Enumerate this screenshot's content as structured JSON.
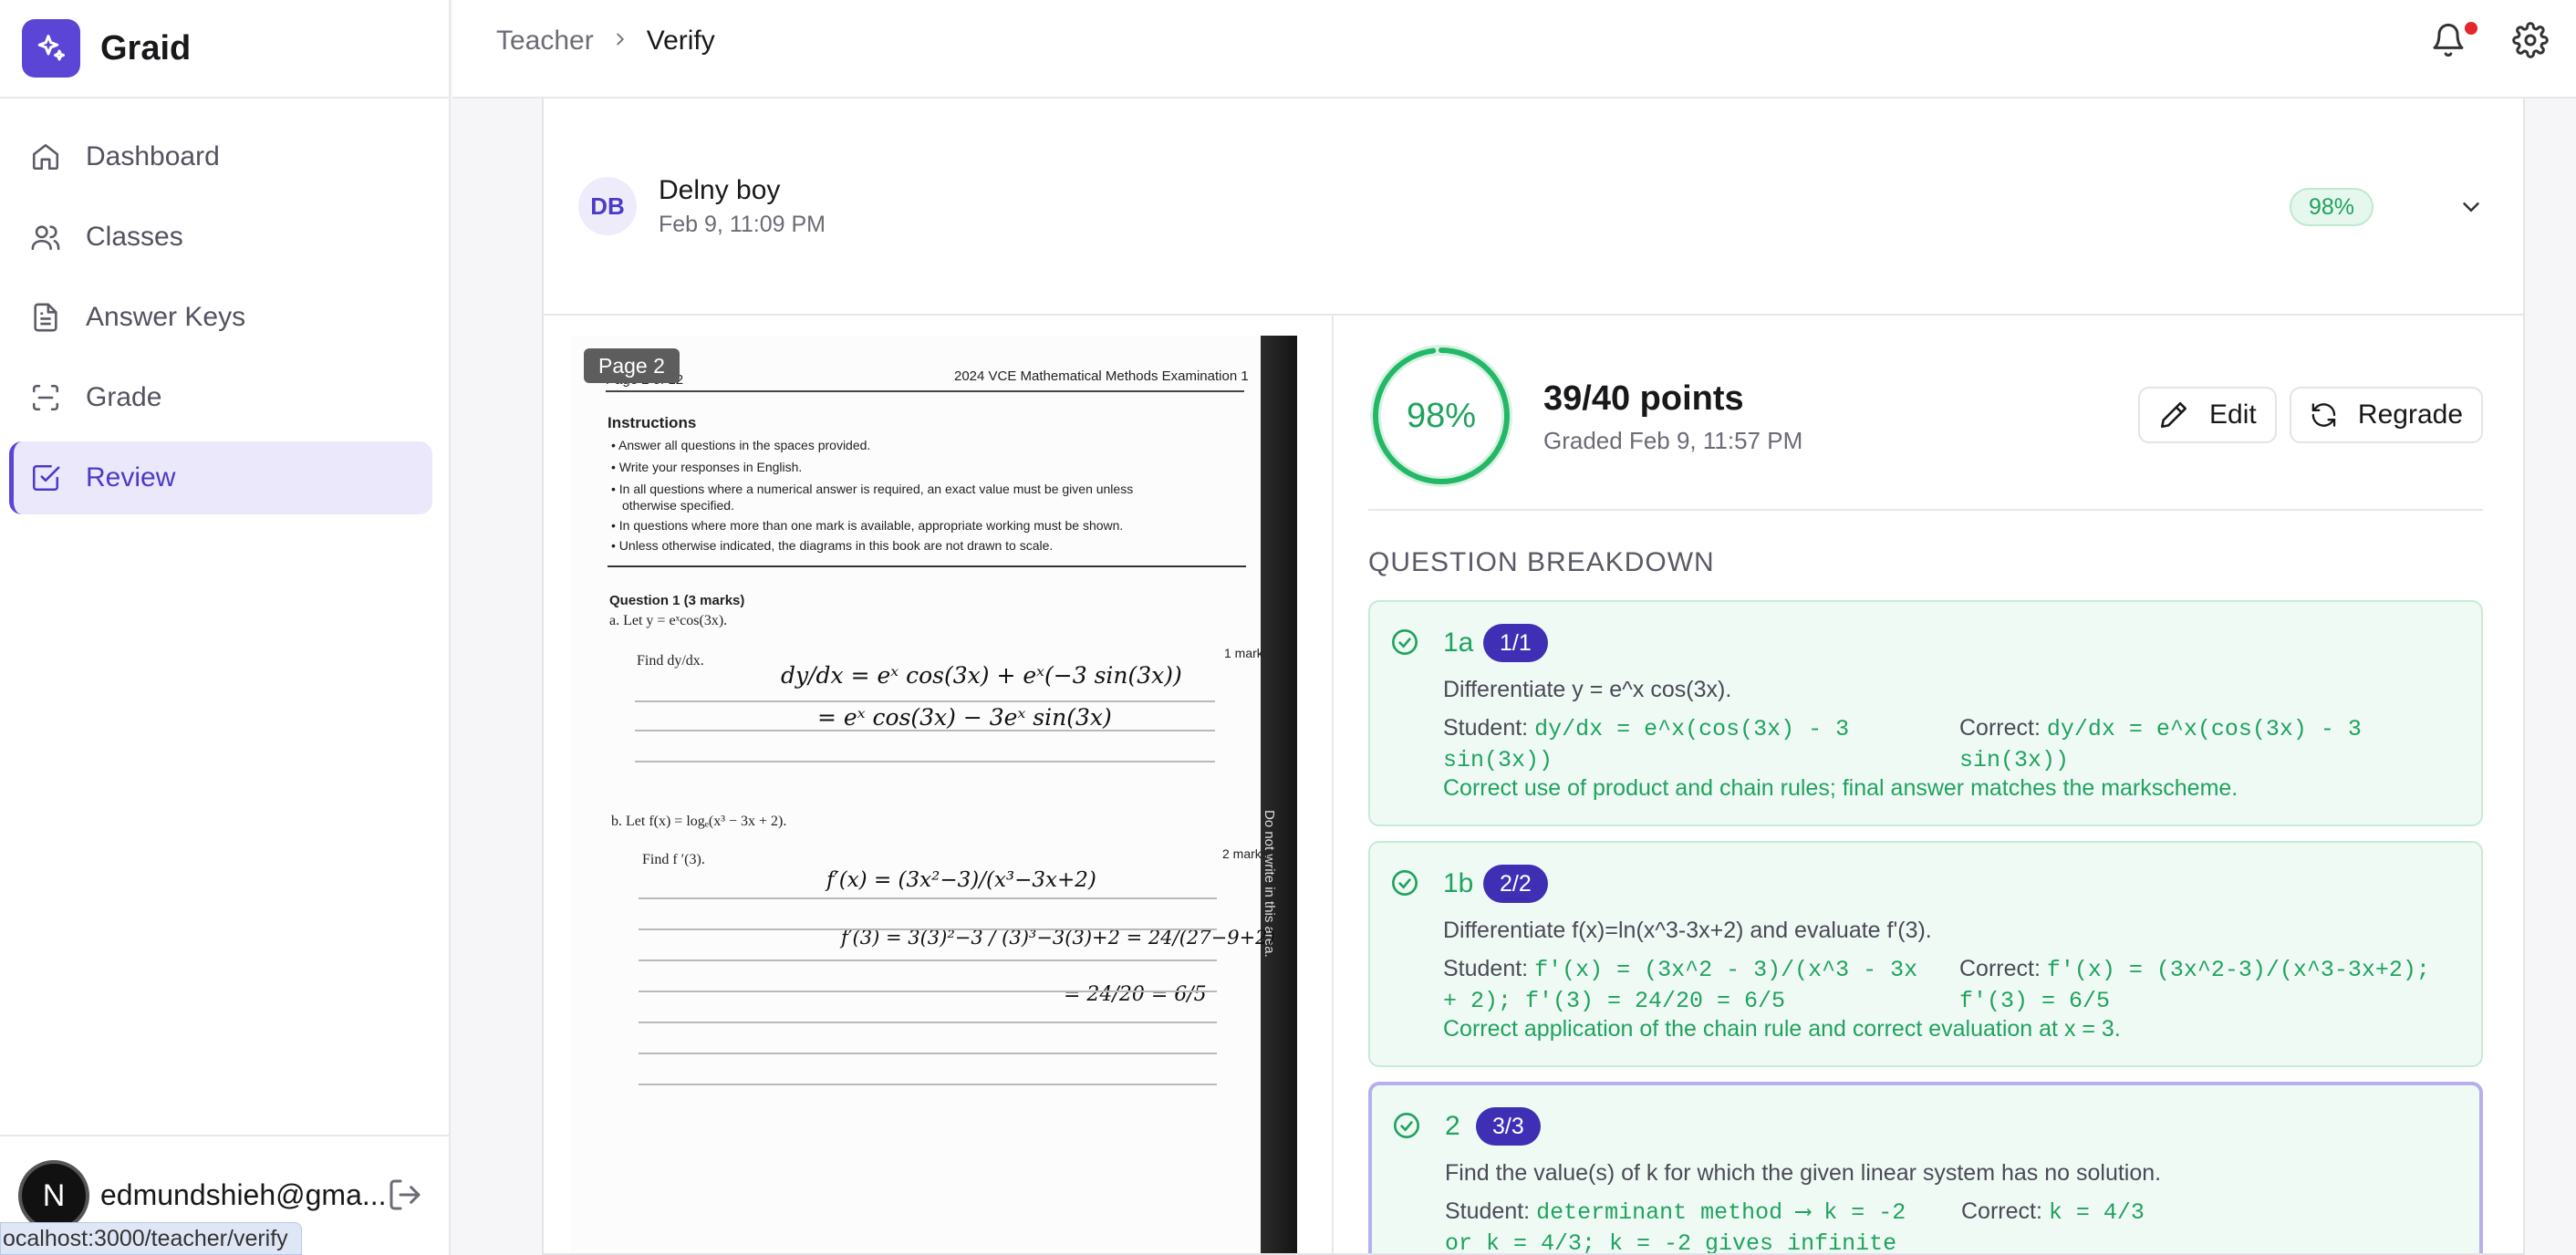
{
  "app": {
    "name": "Graid"
  },
  "sidebar": {
    "items": [
      {
        "label": "Dashboard",
        "icon": "home-icon"
      },
      {
        "label": "Classes",
        "icon": "users-icon"
      },
      {
        "label": "Answer Keys",
        "icon": "file-icon"
      },
      {
        "label": "Grade",
        "icon": "scan-icon"
      },
      {
        "label": "Review",
        "icon": "check-square-icon",
        "active": true
      }
    ],
    "user": {
      "initial": "N",
      "email": "edmundshieh@gma..."
    }
  },
  "status_url": "ocalhost:3000/teacher/verify",
  "breadcrumb": {
    "parent": "Teacher",
    "current": "Verify"
  },
  "submission": {
    "initials": "DB",
    "student_name": "Delny boy",
    "date": "Feb 9, 11:09 PM",
    "score_pill": "98%"
  },
  "page_view": {
    "badge": "Page 2",
    "header_left": "Page 2 of 12",
    "header_right": "2024 VCE Mathematical Methods Examination 1",
    "instructions_title": "Instructions",
    "instructions": [
      "Answer all questions in the spaces provided.",
      "Write your responses in English.",
      "In all questions where a numerical answer is required, an exact value must be given unless",
      "otherwise specified.",
      "In questions where more than one mark is available, appropriate working must be shown.",
      "Unless otherwise indicated, the diagrams in this book are not drawn to scale."
    ],
    "q1_title": "Question 1 (3 marks)",
    "q1a": "a.   Let y = eˣcos(3x).",
    "q1a_find": "Find dy/dx.",
    "q1a_marks": "1 mark",
    "q1b": "b.   Let f(x) = logₑ(x³ − 3x + 2).",
    "q1b_find": "Find f ′(3).",
    "q1b_marks": "2 marks",
    "side_text": "Do not write in this area.",
    "hand_1": "dy/dx = eˣ cos(3x) + eˣ(−3 sin(3x))",
    "hand_2": "= eˣ cos(3x) − 3eˣ sin(3x)",
    "hand_3": "f′(x) = (3x²−3)/(x³−3x+2)",
    "hand_4": "f′(3) = 3(3)²−3 / (3)³−3(3)+2 = 24/(27−9+2)",
    "hand_5": "= 24/20 = 6/5"
  },
  "grade": {
    "percent": "98%",
    "percent_value": 0.98,
    "points": "39/40 points",
    "graded": "Graded Feb 9, 11:57 PM",
    "edit_label": "Edit",
    "regrade_label": "Regrade"
  },
  "breakdown": {
    "title": "QUESTION BREAKDOWN",
    "student_label": "Student:",
    "correct_label": "Correct:",
    "questions": [
      {
        "id": "1a",
        "score": "1/1",
        "prompt": "Differentiate y = e^x cos(3x).",
        "student": "dy/dx = e^x(cos(3x) - 3 sin(3x))",
        "correct": "dy/dx = e^x(cos(3x) - 3 sin(3x))",
        "feedback": "Correct use of product and chain rules; final answer matches the markscheme."
      },
      {
        "id": "1b",
        "score": "2/2",
        "prompt": "Differentiate f(x)=ln(x^3-3x+2) and evaluate f'(3).",
        "student": "f'(x) = (3x^2 - 3)/(x^3 - 3x + 2); f'(3) = 24/20 = 6/5",
        "correct": "f'(x) = (3x^2-3)/(x^3-3x+2); f'(3) = 6/5",
        "feedback": "Correct application of the chain rule and correct evaluation at x = 3."
      },
      {
        "id": "2",
        "score": "3/3",
        "prompt": "Find the value(s) of k for which the given linear system has no solution.",
        "student": "determinant method ⟶ k = -2 or k = 4/3; k = -2 gives infinite",
        "correct": "k = 4/3",
        "feedback": ""
      }
    ]
  }
}
